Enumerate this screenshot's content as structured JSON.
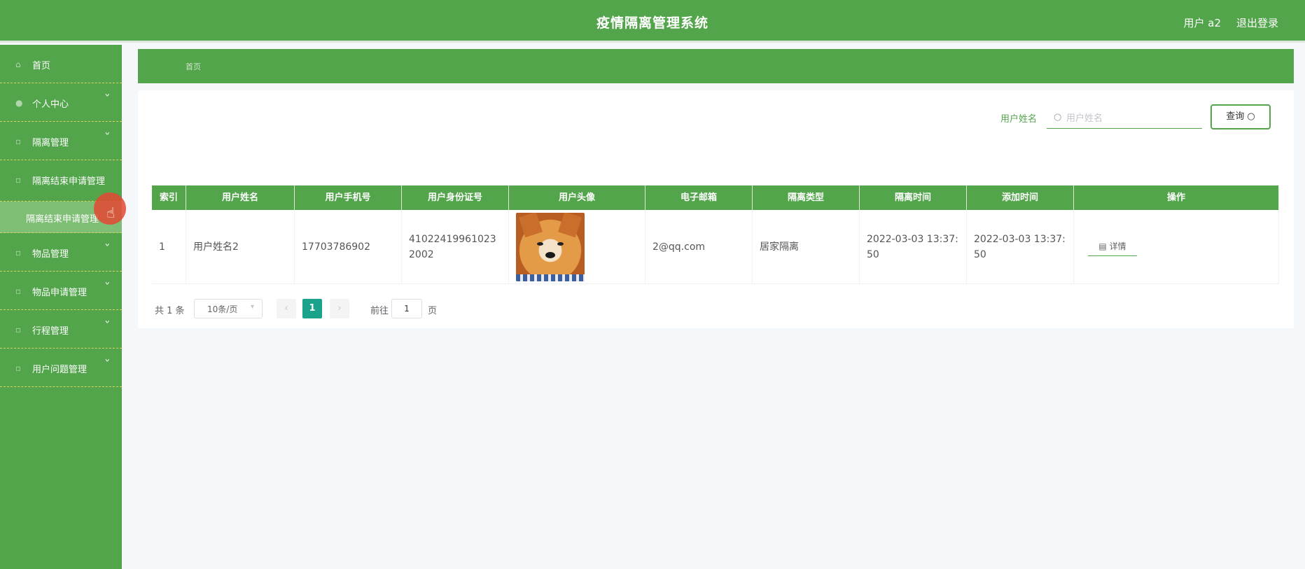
{
  "header": {
    "title": "疫情隔离管理系统",
    "user": "用户 a2",
    "logout": "退出登录"
  },
  "sidebar": {
    "items": [
      {
        "label": "首页",
        "icon": "home-icon"
      },
      {
        "label": "个人中心",
        "icon": "user-icon"
      },
      {
        "label": "隔离管理",
        "icon": "folder-icon"
      },
      {
        "label": "隔离结束申请管理",
        "icon": "folder-icon"
      },
      {
        "label": "物品管理",
        "icon": "folder-icon"
      },
      {
        "label": "物品申请管理",
        "icon": "folder-icon"
      },
      {
        "label": "行程管理",
        "icon": "folder-icon"
      },
      {
        "label": "用户问题管理",
        "icon": "folder-icon"
      }
    ],
    "submenu_active": "隔离结束申请管理"
  },
  "breadcrumb": "首页",
  "search": {
    "label": "用户姓名",
    "placeholder": "用户姓名",
    "button": "查询"
  },
  "table": {
    "headers": [
      "索引",
      "用户姓名",
      "用户手机号",
      "用户身份证号",
      "用户头像",
      "电子邮箱",
      "隔离类型",
      "隔离时间",
      "添加时间",
      "操作"
    ],
    "rows": [
      {
        "index": "1",
        "name": "用户姓名2",
        "phone": "17703786902",
        "id_card": "410224199610232002",
        "email": "2@qq.com",
        "type": "居家隔离",
        "isolation_time": "2022-03-03 13:37:50",
        "add_time": "2022-03-03 13:37:50",
        "action": "详情"
      }
    ]
  },
  "pagination": {
    "total": "共 1 条",
    "page_size": "10条/页",
    "current": "1",
    "goto_label": "前往",
    "goto_value": "1",
    "page_suffix": "页"
  },
  "colors": {
    "primary": "#52a54b",
    "submenu": "#7fbe75",
    "page_active": "#1ba28a"
  }
}
